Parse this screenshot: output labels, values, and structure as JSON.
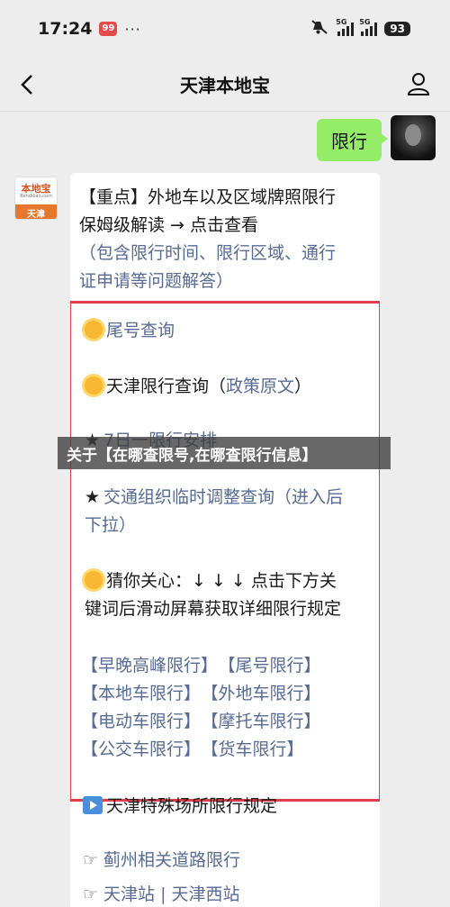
{
  "status_bar": {
    "time": "17:24",
    "notif_badge": "99",
    "more": "···",
    "signal1_label": "5G",
    "signal2_label": "5G",
    "battery": "93"
  },
  "nav": {
    "title": "天津本地宝"
  },
  "messages": {
    "user_message": "限行",
    "bot_avatar": {
      "brand": "本地宝",
      "domain": "Bendibao.com",
      "city": "天津"
    },
    "intro_line1": "【重点】外地车以及区域牌照限行",
    "intro_line2": "保姆级解读 → 点击查看",
    "intro_sub1": "（包含限行时间、限行区域、通行",
    "intro_sub2": "证申请等问题解答）",
    "menu": {
      "tail_number": "尾号查询",
      "tianjin_query": "天津限行查询（",
      "policy_link": "政策原文",
      "tianjin_query_end": "）",
      "seven_day": "7日一限行安排",
      "traffic_adjust": "交通组织临时调整查询（进入后",
      "traffic_adjust2": "下拉）",
      "guess_line1": "猜你关心：↓ ↓ ↓ 点击下方关",
      "guess_line2": "键词后滑动屏幕获取详细限行规定"
    },
    "tags": [
      [
        "【早晚高峰限行】",
        "【尾号限行】"
      ],
      [
        "【本地车限行】",
        "【外地车限行】"
      ],
      [
        "【电动车限行】",
        "【摩托车限行】"
      ],
      [
        "【公交车限行】",
        "【货车限行】"
      ]
    ],
    "special_places": "天津特殊场所限行规定",
    "jizhou_roads": "蓟州相关道路限行",
    "stations": "天津站 | 天津西站"
  },
  "overlay": {
    "title": "关于【在哪查限号,在哪查限行信息】"
  },
  "colors": {
    "background": "#ededed",
    "user_bubble": "#95ec69",
    "link": "#576b95",
    "highlight_border": "#e0404a"
  }
}
